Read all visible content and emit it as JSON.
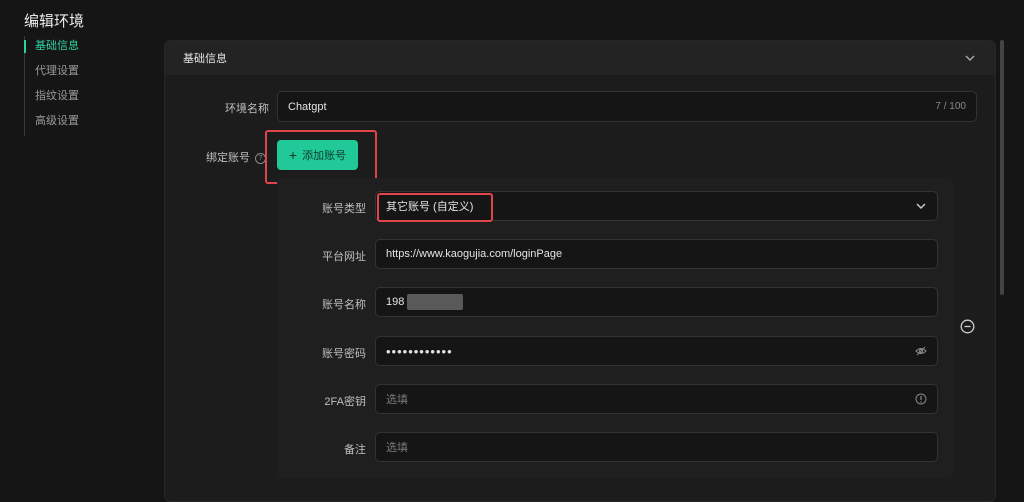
{
  "page": {
    "title": "编辑环境"
  },
  "sidebar": {
    "items": [
      {
        "label": "基础信息",
        "active": true
      },
      {
        "label": "代理设置",
        "active": false
      },
      {
        "label": "指纹设置",
        "active": false
      },
      {
        "label": "高级设置",
        "active": false
      }
    ]
  },
  "panel": {
    "title": "基础信息",
    "env_name": {
      "label": "环境名称",
      "value": "Chatgpt",
      "counter": "7 / 100"
    },
    "bind": {
      "label": "绑定账号",
      "add_button": "添加账号"
    },
    "account": {
      "type": {
        "label": "账号类型",
        "value": "其它账号 (自定义)"
      },
      "url": {
        "label": "平台网址",
        "value": "https://www.kaogujia.com/loginPage"
      },
      "name": {
        "label": "账号名称",
        "value": "198"
      },
      "password": {
        "label": "账号密码",
        "value": "••••••••••••"
      },
      "twofa": {
        "label": "2FA密钥",
        "placeholder": "选填"
      },
      "note": {
        "label": "备注",
        "placeholder": "选填"
      }
    }
  },
  "colors": {
    "accent": "#20c997",
    "highlight": "#e0454b",
    "background": "#151515"
  },
  "icons": [
    "chevron-down-icon",
    "plus-icon",
    "help-icon",
    "eye-off-icon",
    "info-icon",
    "remove-circle-icon"
  ]
}
